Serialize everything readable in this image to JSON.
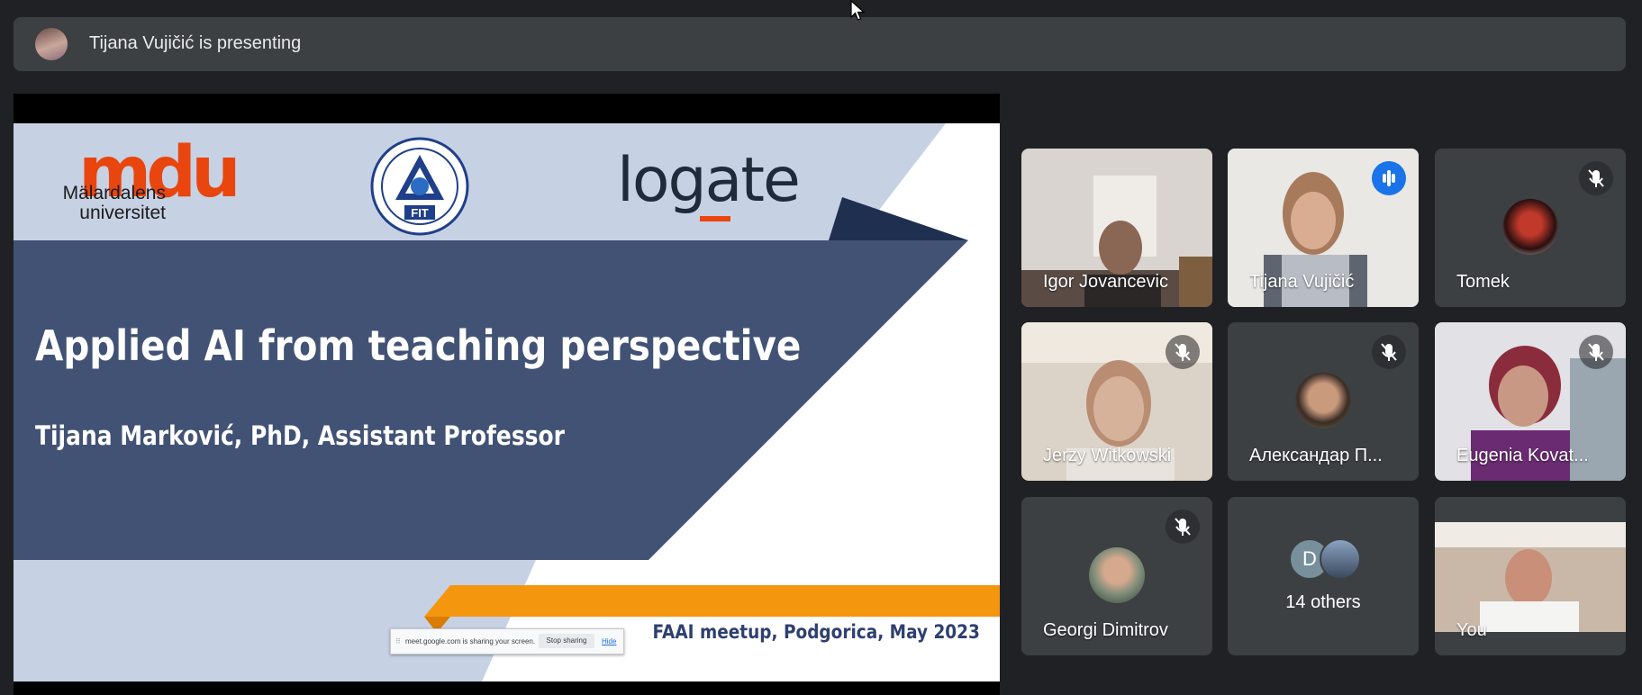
{
  "banner": {
    "presenter_text": "Tijana Vujičić is presenting"
  },
  "slide": {
    "logo_mdu_name": "Mälardalens universitet",
    "logo_fit_label": "FIT",
    "logo_logate": "logate",
    "title": "Applied AI from teaching perspective",
    "subtitle": "Tijana Marković, PhD, Assistant Professor",
    "footer": "FAAI meetup, Podgorica, May 2023",
    "colors": {
      "panel_blue": "#415275",
      "light_band": "#c7d1e4",
      "orange_ribbon": "#f5960f",
      "navy_triangle": "#1f2f4f"
    }
  },
  "share_bar": {
    "grip": "⠿",
    "message": "meet.google.com is sharing your screen.",
    "stop_label": "Stop sharing",
    "hide_label": "Hide"
  },
  "participants": [
    {
      "name": "Igor Jovancevic",
      "mic": "none",
      "view": "video"
    },
    {
      "name": "Tijana Vujičić",
      "mic": "speaking",
      "view": "video"
    },
    {
      "name": "Tomek",
      "mic": "muted",
      "view": "avatar"
    },
    {
      "name": "Jerzy Witkowski",
      "mic": "muted",
      "view": "video"
    },
    {
      "name": "Александар П...",
      "mic": "muted",
      "view": "avatar"
    },
    {
      "name": "Eugenia Kovat...",
      "mic": "muted",
      "view": "video"
    },
    {
      "name": "Georgi Dimitrov",
      "mic": "muted",
      "view": "avatar"
    },
    {
      "name": "14 others",
      "mic": "none",
      "view": "group",
      "initial": "D"
    },
    {
      "name": "You",
      "mic": "none",
      "view": "video"
    }
  ],
  "icons": {
    "mute": "mic-off-icon",
    "speaking": "audio-level-icon",
    "cursor": "mouse-cursor-icon"
  },
  "accent_color": "#8ab4f8",
  "speaking_color": "#1a73e8"
}
